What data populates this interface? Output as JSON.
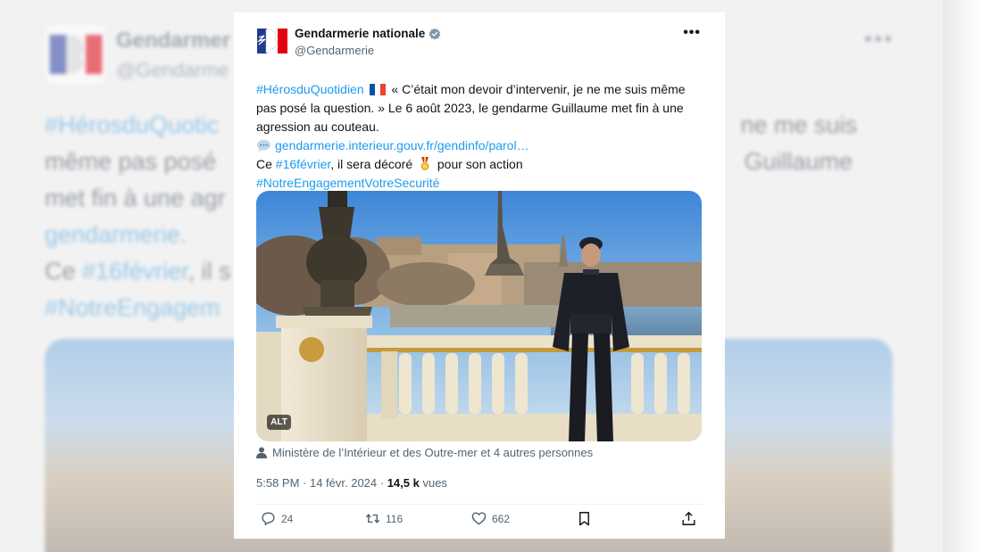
{
  "background": {
    "name": "Gendarmer",
    "handle": "@Gendarme",
    "dots": "•••",
    "lines": [
      {
        "tag": "#HérosduQuotic",
        "rest": "",
        "right": "ne me suis"
      },
      {
        "tag": "",
        "rest": "même pas posé",
        "right": "Guillaume"
      },
      {
        "tag": "",
        "rest": "met fin à une agr",
        "right": ""
      },
      {
        "tag": "gendarmerie.",
        "rest": "",
        "right": ""
      },
      {
        "tag": "#16février",
        "pre": "Ce ",
        "rest": ", il s",
        "right": ""
      },
      {
        "tag": "#NotreEngagem",
        "rest": "",
        "right": ""
      }
    ]
  },
  "tweet": {
    "author_name": "Gendarmerie nationale",
    "handle": "@Gendarmerie",
    "more_label": "•••",
    "text": {
      "hashtag1": "#HérosduQuotidien",
      "quote": "« C’était mon devoir d’intervenir, je ne me suis même pas posé la question. » Le 6 août 2023, le gendarme Guillaume met fin à une agression au couteau.",
      "link": "gendarmerie.interieur.gouv.fr/gendinfo/parol…",
      "line_ce": "Ce ",
      "hashtag2": "#16février",
      "decoration": ", il sera décoré",
      "action": "pour son action",
      "hashtag3": "#NotreEngagementVotreSecurité"
    },
    "alt_badge": "ALT",
    "tagged_people": "Ministère de l’Intérieur et des Outre-mer et 4 autres personnes",
    "timestamp": "5:58 PM · 14 févr. 2024 · ",
    "views_count": "14,5 k",
    "views_label": " vues",
    "actions": {
      "replies": "24",
      "reposts": "116",
      "likes": "662"
    },
    "colors": {
      "link": "#1d9bf0",
      "text": "#0f1419",
      "muted": "#536471"
    },
    "icons": [
      "gendarmerie-logo-icon",
      "verified-badge-icon",
      "more-icon",
      "france-flag-icon",
      "speech-bubble-icon",
      "medal-icon",
      "person-icon",
      "reply-icon",
      "repost-icon",
      "like-icon",
      "bookmark-icon",
      "share-icon"
    ]
  }
}
